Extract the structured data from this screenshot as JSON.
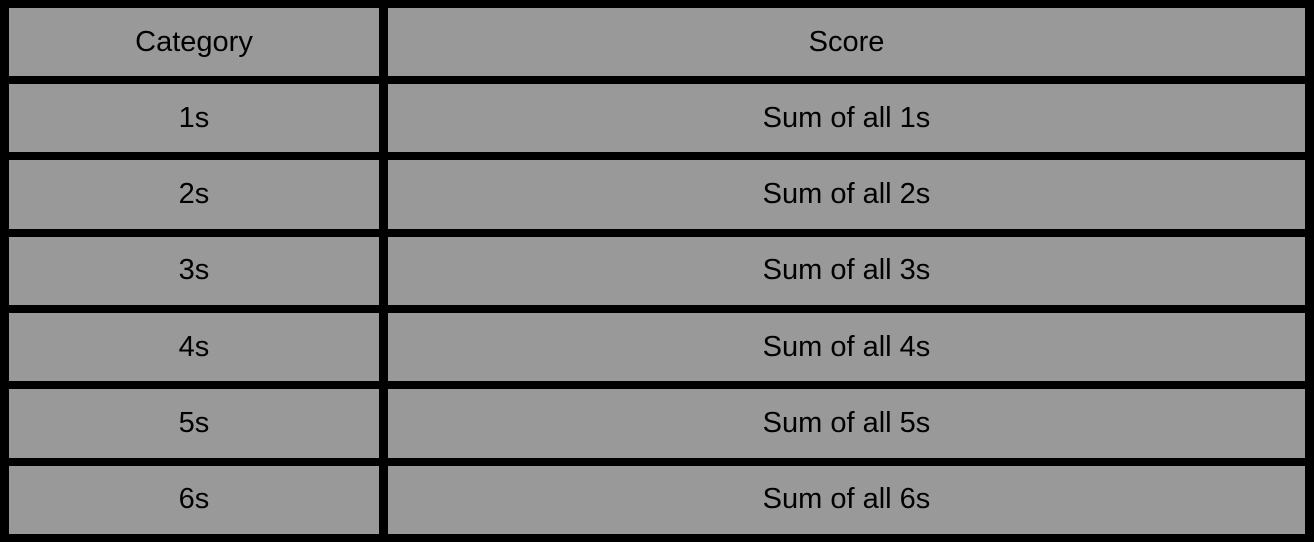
{
  "table": {
    "headers": {
      "category": "Category",
      "score": "Score"
    },
    "rows": [
      {
        "category": "1s",
        "score": "Sum of all 1s"
      },
      {
        "category": "2s",
        "score": "Sum of all 2s"
      },
      {
        "category": "3s",
        "score": "Sum of all 3s"
      },
      {
        "category": "4s",
        "score": "Sum of all 4s"
      },
      {
        "category": "5s",
        "score": "Sum of all 5s"
      },
      {
        "category": "6s",
        "score": "Sum of all 6s"
      }
    ]
  },
  "colors": {
    "background": "#000000",
    "cell": "#999999",
    "text": "#000000"
  }
}
